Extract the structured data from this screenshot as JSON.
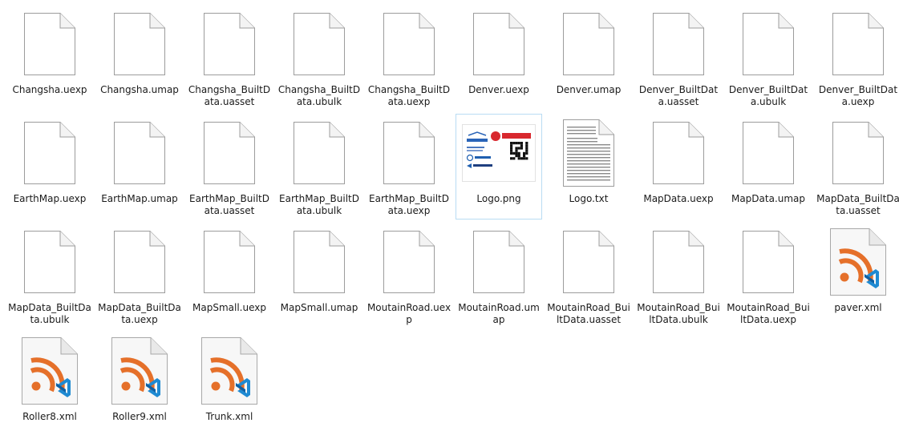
{
  "window": {
    "view": "large-icons"
  },
  "colors": {
    "page_background": "#ffffff",
    "selection_border": "#b9dcf3",
    "rss_orange": "#e5702a",
    "vscode_blue": "#1f8ad2"
  },
  "files": [
    {
      "name": "Changsha.uexp",
      "icon": "blank-file-icon"
    },
    {
      "name": "Changsha.umap",
      "icon": "blank-file-icon"
    },
    {
      "name": "Changsha_BuiltData.uasset",
      "icon": "blank-file-icon"
    },
    {
      "name": "Changsha_BuiltData.ubulk",
      "icon": "blank-file-icon"
    },
    {
      "name": "Changsha_BuiltData.uexp",
      "icon": "blank-file-icon"
    },
    {
      "name": "Denver.uexp",
      "icon": "blank-file-icon"
    },
    {
      "name": "Denver.umap",
      "icon": "blank-file-icon"
    },
    {
      "name": "Denver_BuiltData.uasset",
      "icon": "blank-file-icon"
    },
    {
      "name": "Denver_BuiltData.ubulk",
      "icon": "blank-file-icon"
    },
    {
      "name": "Denver_BuiltData.uexp",
      "icon": "blank-file-icon"
    },
    {
      "name": "EarthMap.uexp",
      "icon": "blank-file-icon"
    },
    {
      "name": "EarthMap.umap",
      "icon": "blank-file-icon"
    },
    {
      "name": "EarthMap_BuiltData.uasset",
      "icon": "blank-file-icon"
    },
    {
      "name": "EarthMap_BuiltData.ubulk",
      "icon": "blank-file-icon"
    },
    {
      "name": "EarthMap_BuiltData.uexp",
      "icon": "blank-file-icon"
    },
    {
      "name": "Logo.png",
      "icon": "logo-thumbnail-icon",
      "selected": true
    },
    {
      "name": "Logo.txt",
      "icon": "text-file-icon"
    },
    {
      "name": "MapData.uexp",
      "icon": "blank-file-icon"
    },
    {
      "name": "MapData.umap",
      "icon": "blank-file-icon"
    },
    {
      "name": "MapData_BuiltData.uasset",
      "icon": "blank-file-icon"
    },
    {
      "name": "MapData_BuiltData.ubulk",
      "icon": "blank-file-icon"
    },
    {
      "name": "MapData_BuiltData.uexp",
      "icon": "blank-file-icon"
    },
    {
      "name": "MapSmall.uexp",
      "icon": "blank-file-icon"
    },
    {
      "name": "MapSmall.umap",
      "icon": "blank-file-icon"
    },
    {
      "name": "MoutainRoad.uexp",
      "icon": "blank-file-icon"
    },
    {
      "name": "MoutainRoad.umap",
      "icon": "blank-file-icon"
    },
    {
      "name": "MoutainRoad_BuiltData.uasset",
      "icon": "blank-file-icon"
    },
    {
      "name": "MoutainRoad_BuiltData.ubulk",
      "icon": "blank-file-icon"
    },
    {
      "name": "MoutainRoad_BuiltData.uexp",
      "icon": "blank-file-icon"
    },
    {
      "name": "paver.xml",
      "icon": "rss-xml-file-icon"
    },
    {
      "name": "Roller8.xml",
      "icon": "rss-xml-file-icon"
    },
    {
      "name": "Roller9.xml",
      "icon": "rss-xml-file-icon"
    },
    {
      "name": "Trunk.xml",
      "icon": "rss-xml-file-icon"
    }
  ]
}
